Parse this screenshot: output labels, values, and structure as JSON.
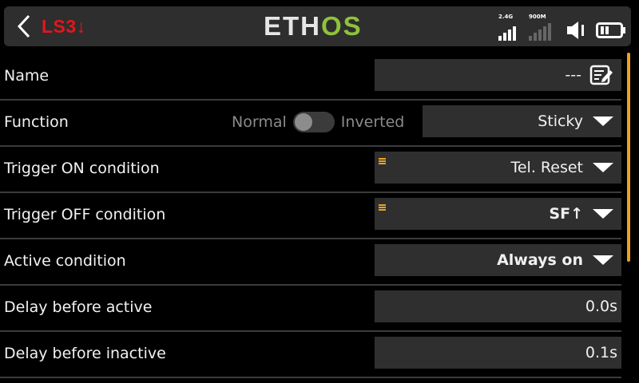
{
  "header": {
    "back_icon": "chevron-left-icon",
    "screen_title": "LS3↓",
    "logo_left": "ETH",
    "logo_right": "OS",
    "status": {
      "rf_24g_label": "2.4G",
      "rf_900m_label": "900M",
      "volume_icon": "speaker-icon",
      "battery_icon": "battery-icon"
    },
    "colors": {
      "title": "#e3161d",
      "logo_accent": "#8fc23c",
      "marker": "#f0a020"
    }
  },
  "rows": [
    {
      "label": "Name",
      "value": "---",
      "icon": "edit-icon"
    },
    {
      "label": "Function",
      "toggle_left": "Normal",
      "toggle_right": "Inverted",
      "value": "Sticky",
      "toggle_state": "off"
    },
    {
      "label": "Trigger ON condition",
      "value": "Tel. Reset"
    },
    {
      "label": "Trigger OFF condition",
      "value": "SF↑"
    },
    {
      "label": "Active condition",
      "value": "Always on"
    },
    {
      "label": "Delay before active",
      "value": "0.0s"
    },
    {
      "label": "Delay before inactive",
      "value": "0.1s"
    }
  ]
}
